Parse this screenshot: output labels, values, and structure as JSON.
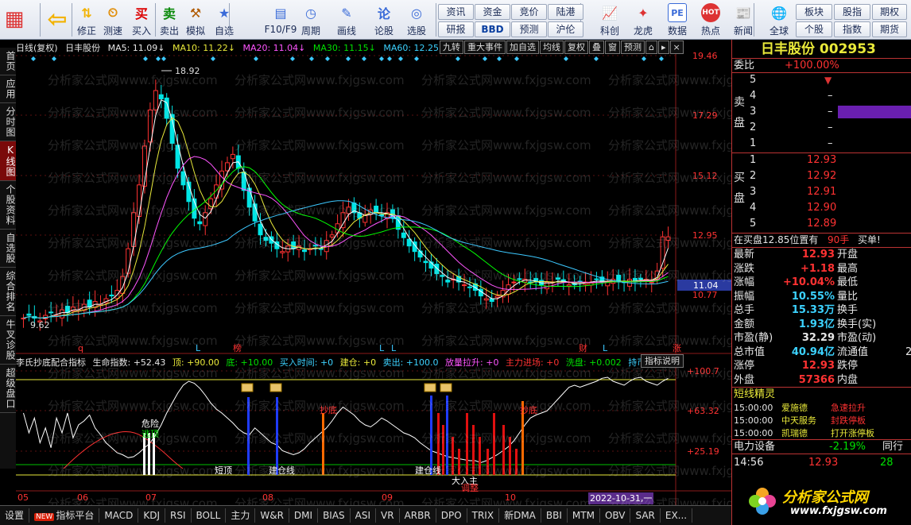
{
  "toolbar": {
    "buttons": [
      {
        "label": "",
        "icon": "grid-icon"
      },
      {
        "label": "",
        "icon": "back-arrow-icon"
      },
      {
        "label": "修正",
        "icon": "up-down-icon"
      },
      {
        "label": "测速",
        "icon": "speed-icon"
      },
      {
        "label": "买入",
        "icon": "buy-icon"
      },
      {
        "label": "卖出",
        "icon": "sell-icon"
      },
      {
        "label": "模拟",
        "icon": "hammer-icon"
      },
      {
        "label": "自选",
        "icon": "star-icon"
      },
      {
        "label": "F10/F9",
        "icon": "f10-icon"
      },
      {
        "label": "周期",
        "icon": "period-icon"
      },
      {
        "label": "画线",
        "icon": "pencil-icon"
      },
      {
        "label": "论股",
        "icon": "discuss-icon"
      },
      {
        "label": "选股",
        "icon": "select-stock-icon"
      }
    ],
    "grid_left": [
      [
        "资讯",
        "资金",
        "竞价",
        "陆港"
      ],
      [
        "研报",
        "BBD",
        "预测",
        "沪伦"
      ]
    ],
    "mid_buttons": [
      {
        "label": "科创",
        "icon": "kechuang-icon"
      },
      {
        "label": "龙虎",
        "icon": "dragon-tiger-icon"
      },
      {
        "label": "数据",
        "icon": "pe-icon"
      },
      {
        "label": "热点",
        "icon": "hot-icon"
      },
      {
        "label": "新闻",
        "icon": "news-icon"
      },
      {
        "label": "全球",
        "icon": "globe-icon"
      }
    ],
    "grid_right": [
      [
        "板块",
        "股指",
        "期权"
      ],
      [
        "个股",
        "指数",
        "期货"
      ]
    ],
    "pe_text": "PE",
    "hot_text": "HOT"
  },
  "left_tabs": [
    "首页",
    "应用",
    "分时图",
    "K线图",
    "个股资料",
    "自选股",
    "综合排名",
    "牛叉诊股",
    "超级盘口"
  ],
  "main_header": {
    "period": "日线(复权)",
    "name": "日丰股份",
    "ma5": "MA5: 11.09↓",
    "ma10": "MA10: 11.22↓",
    "ma20": "MA20: 11.04↓",
    "ma30": "MA30: 11.15↓",
    "ma60": "MA60: 12.25↓"
  },
  "chart_buttons": [
    "九转",
    "重大事件",
    "加自选",
    "均线",
    "复权",
    "叠",
    "窗",
    "预测"
  ],
  "price_axis": [
    "19.46",
    "17.29",
    "15.12",
    "12.95",
    "10.77"
  ],
  "current_price_tag": "11.04",
  "annotations": {
    "high": "18.92",
    "low": "9.62"
  },
  "event_markers": [
    "q",
    "L",
    "榜",
    "L",
    "L",
    "财",
    "L",
    "涨"
  ],
  "sub_header": {
    "name": "李氏抄底配合指标",
    "life": "生命指数: +52.43",
    "top": "顶: +90.00",
    "bottom": "底: +10.00",
    "buy_time": "买入时间: +0",
    "build": "建仓: +0",
    "sell": "卖出: +100.0",
    "volume_up": "放量拉升: +0",
    "main_in": "主力进场: +0",
    "wash": "洗盘: +0.002",
    "hold": "持币区域"
  },
  "sub_explain": "指标说明",
  "sub_axis": [
    "+100.7",
    "+63.32",
    "+25.19"
  ],
  "sub_labels": [
    "危险",
    "逃顶",
    "抄底",
    "抄底",
    "短顶",
    "建仓线",
    "建仓线",
    "大入主",
    "调整"
  ],
  "x_axis": [
    "05",
    "06",
    "07",
    "08",
    "09",
    "10"
  ],
  "date_tag": "2022-10-31,一",
  "right_panel": {
    "title": "日丰股份 002953",
    "weibi_label": "委比",
    "weibi_value": "+100.00%",
    "sell_label": [
      "卖",
      "盘"
    ],
    "buy_label": [
      "买",
      "盘"
    ],
    "sell_levels": [
      {
        "n": "5",
        "price": "",
        "vol": ""
      },
      {
        "n": "4",
        "price": "–",
        "vol": ""
      },
      {
        "n": "3",
        "price": "–",
        "vol": ""
      },
      {
        "n": "2",
        "price": "–",
        "vol": ""
      },
      {
        "n": "1",
        "price": "–",
        "vol": ""
      }
    ],
    "buy_levels": [
      {
        "n": "1",
        "price": "12.93"
      },
      {
        "n": "2",
        "price": "12.92"
      },
      {
        "n": "3",
        "price": "12.91"
      },
      {
        "n": "4",
        "price": "12.90"
      },
      {
        "n": "5",
        "price": "12.89"
      }
    ],
    "status_line": {
      "text": "在买盘12.85位置有",
      "hands": "90手",
      "tag": "买单!"
    },
    "quote_rows": [
      {
        "l1": "最新",
        "v1": "12.93",
        "l2": "开盘",
        "v2": ""
      },
      {
        "l1": "涨跌",
        "v1": "+1.18",
        "l2": "最高",
        "v2": ""
      },
      {
        "l1": "涨幅",
        "v1": "+10.04%",
        "l2": "最低",
        "v2": ""
      },
      {
        "l1": "振幅",
        "v1": "10.55%",
        "l2": "量比",
        "v2": ""
      },
      {
        "l1": "总手",
        "v1": "15.33万",
        "l2": "换手",
        "v2": ""
      },
      {
        "l1": "金额",
        "v1": "1.93亿",
        "l2": "换手(实)",
        "v2": ""
      },
      {
        "l1": "市盈(静)",
        "v1": "32.29",
        "l2": "市盈(动)",
        "v2": ""
      },
      {
        "l1": "总市值",
        "v1": "40.94亿",
        "l2": "流通值",
        "v2": "2"
      },
      {
        "l1": "涨停",
        "v1": "12.93",
        "l2": "跌停",
        "v2": ""
      },
      {
        "l1": "外盘",
        "v1": "57366",
        "l2": "内盘",
        "v2": ""
      }
    ],
    "short_title": "短线精灵",
    "short_rows": [
      {
        "time": "15:00:00",
        "name": "爱施德",
        "event": "急速拉升"
      },
      {
        "time": "15:00:00",
        "name": "中天服务",
        "event": "封跌停板"
      },
      {
        "time": "15:00:00",
        "name": "凯瑞德",
        "event": "打开涨停板"
      }
    ],
    "sector_row": {
      "name": "电力设备",
      "change": "-2.19%",
      "tag": "同行"
    },
    "tick_row": {
      "time": "14:56",
      "price": "12.93",
      "vol": "28"
    }
  },
  "bottom_tabs": [
    "设置",
    "指标平台",
    "MACD",
    "KDJ",
    "RSI",
    "BOLL",
    "主力",
    "W&R",
    "DMI",
    "BIAS",
    "ASI",
    "VR",
    "ARBR",
    "DPO",
    "TRIX",
    "新DMA",
    "BBI",
    "MTM",
    "OBV",
    "SAR",
    "EX..."
  ],
  "new_badge": "NEW",
  "watermark": "分析家公式网www.fxjgsw.com",
  "logo": {
    "text": "分析家公式网",
    "url": "www.fxjgsw.com"
  },
  "colors": {
    "up": "#ff3232",
    "down": "#00e5e5",
    "ma5": "#ffffff",
    "ma10": "#e9e93a",
    "ma20": "#ff55ff",
    "ma30": "#00ff00",
    "ma60": "#3cc8ff"
  }
}
